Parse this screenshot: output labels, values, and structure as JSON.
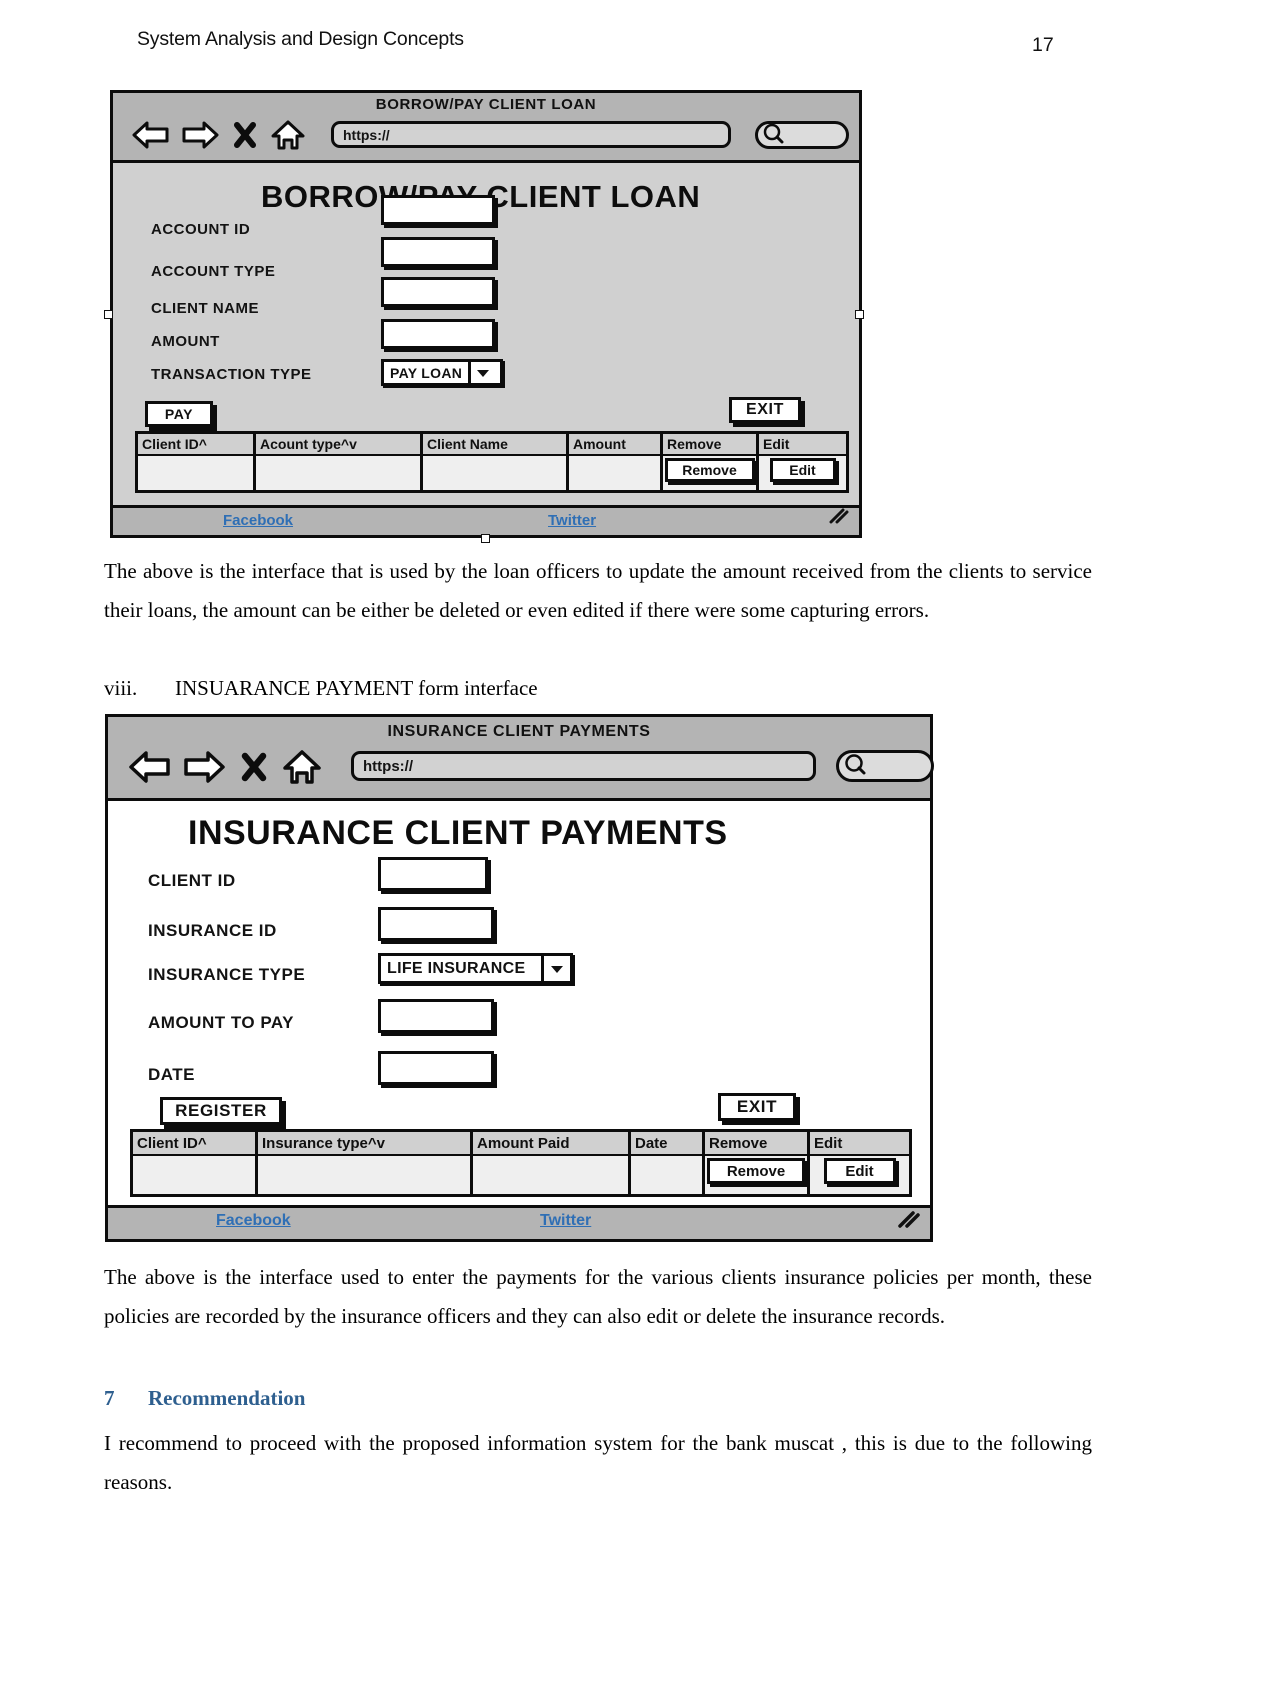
{
  "header": {
    "doc_title": "System Analysis and Design Concepts",
    "page_number": "17"
  },
  "mockup_loan": {
    "chrome": {
      "title": "BORROW/PAY CLIENT LOAN",
      "url_value": "https://",
      "back_icon": "back-arrow-icon",
      "forward_icon": "forward-arrow-icon",
      "stop_icon": "close-x-icon",
      "home_icon": "home-icon",
      "search_icon": "magnifier-icon"
    },
    "form_title": "BORROW/PAY CLIENT LOAN",
    "fields": [
      {
        "label": "ACCOUNT ID",
        "value": "",
        "type": "text"
      },
      {
        "label": "ACCOUNT TYPE",
        "value": "",
        "type": "text"
      },
      {
        "label": "CLIENT NAME",
        "value": "",
        "type": "text"
      },
      {
        "label": "AMOUNT",
        "value": "",
        "type": "text"
      },
      {
        "label": "TRANSACTION TYPE",
        "value": "PAY LOAN",
        "type": "select"
      }
    ],
    "buttons": {
      "submit": "PAY",
      "exit": "EXIT"
    },
    "grid": {
      "columns": [
        "Client ID^",
        "Acount type^v",
        "Client Name",
        "Amount",
        "Remove",
        "Edit"
      ],
      "row_actions": {
        "remove": "Remove",
        "edit": "Edit"
      },
      "rows": []
    },
    "footer": {
      "facebook": "Facebook",
      "twitter": "Twitter"
    }
  },
  "caption_loan": "The above is the interface that is used by the loan officers to update the amount received from the clients to service their loans, the amount can be either be deleted or even edited if there were some capturing errors.",
  "list_item": {
    "marker": "viii.",
    "text": "INSUARANCE PAYMENT form interface"
  },
  "mockup_insurance": {
    "chrome": {
      "title": "INSURANCE CLIENT PAYMENTS",
      "url_value": "https://",
      "back_icon": "back-arrow-icon",
      "forward_icon": "forward-arrow-icon",
      "stop_icon": "close-x-icon",
      "home_icon": "home-icon",
      "search_icon": "magnifier-icon"
    },
    "form_title": "INSURANCE CLIENT PAYMENTS",
    "fields": [
      {
        "label": "CLIENT ID",
        "value": "",
        "type": "text"
      },
      {
        "label": "INSURANCE ID",
        "value": "",
        "type": "text"
      },
      {
        "label": "INSURANCE TYPE",
        "value": "LIFE INSURANCE",
        "type": "select"
      },
      {
        "label": "AMOUNT TO PAY",
        "value": "",
        "type": "text"
      },
      {
        "label": "DATE",
        "value": "",
        "type": "text"
      }
    ],
    "buttons": {
      "submit": "REGISTER",
      "exit": "EXIT"
    },
    "grid": {
      "columns": [
        "Client ID^",
        "Insurance type^v",
        "Amount Paid",
        "Date",
        "Remove",
        "Edit"
      ],
      "row_actions": {
        "remove": "Remove",
        "edit": "Edit"
      },
      "rows": []
    },
    "footer": {
      "facebook": "Facebook",
      "twitter": "Twitter"
    }
  },
  "caption_insurance": "The above is the interface used to enter the payments for the various clients insurance policies per month, these policies are recorded by the insurance officers and they can also edit or delete the insurance records.",
  "recommendation": {
    "number": "7",
    "title": "Recommendation",
    "body": "I recommend to proceed with the proposed information system for the bank muscat , this is due to the following reasons."
  }
}
